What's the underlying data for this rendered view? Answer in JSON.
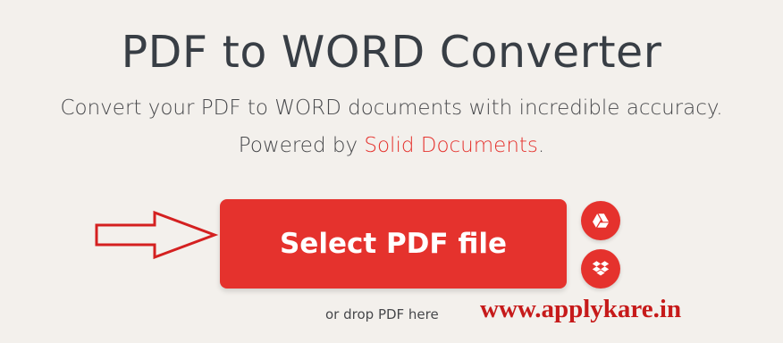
{
  "header": {
    "title": "PDF to WORD Converter",
    "subtitle_line1": "Convert your PDF to WORD documents with incredible accuracy.",
    "powered_prefix": "Powered by ",
    "powered_link": "Solid Documents",
    "powered_suffix": "."
  },
  "upload": {
    "select_label": "Select PDF file",
    "drop_hint": "or drop PDF here",
    "cloud_buttons": [
      "google-drive-icon",
      "dropbox-icon"
    ]
  },
  "watermark": "www.applykare.in",
  "colors": {
    "accent": "#e5322d",
    "background": "#f3f0ec",
    "title": "#383e45",
    "watermark": "#c61a1a"
  }
}
